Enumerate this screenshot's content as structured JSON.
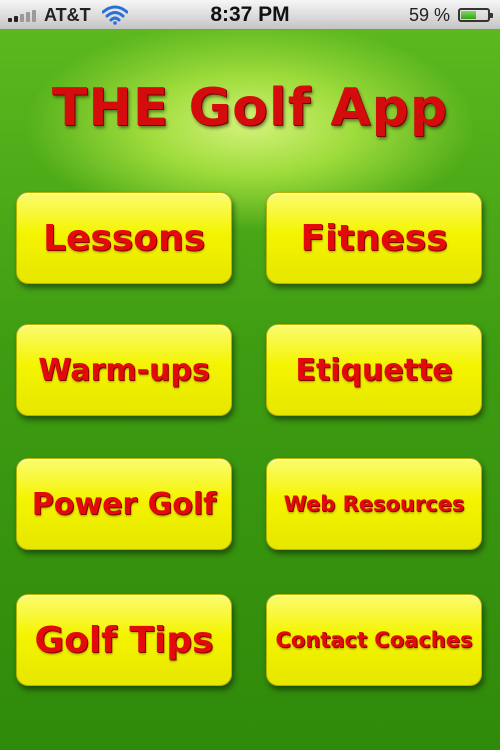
{
  "status_bar": {
    "carrier": "AT&T",
    "time": "8:37 PM",
    "battery_percent": "59 %",
    "battery_level": 0.59,
    "signal_icon": "signal-bars-icon",
    "wifi_icon": "wifi-icon",
    "battery_icon": "battery-icon"
  },
  "app": {
    "title": "THE Golf App",
    "title_color": "#d40c0c",
    "background_color": "#3e9c12",
    "button_color": "#f4f400",
    "button_text_color": "#e20a0a"
  },
  "menu": {
    "lessons": "Lessons",
    "fitness": "Fitness",
    "warmups": "Warm-ups",
    "etiquette": "Etiquette",
    "power_golf": "Power Golf",
    "web_resources": "Web Resources",
    "golf_tips": "Golf Tips",
    "contact_coaches": "Contact Coaches"
  }
}
